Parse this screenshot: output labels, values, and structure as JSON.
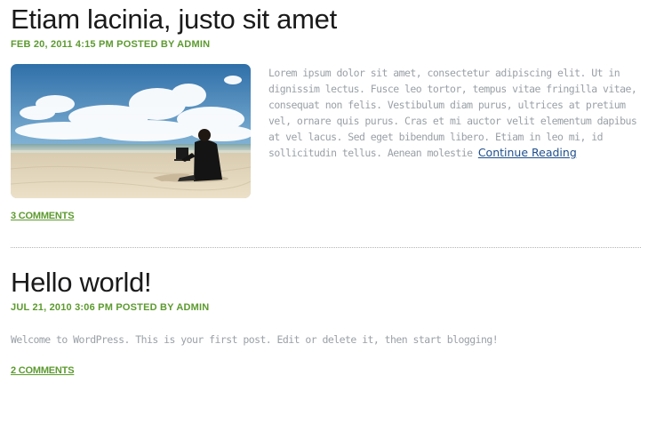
{
  "posts": [
    {
      "title": "Etiam lacinia, justo sit amet",
      "meta": "FEB 20, 2011 4:15 PM POSTED BY ADMIN",
      "excerpt": "Lorem ipsum dolor sit amet, consectetur adipiscing elit. Ut in dignissim lectus. Fusce leo tortor, tempus vitae fringilla vitae, consequat non felis. Vestibulum diam purus, ultrices at pretium vel, ornare quis purus. Cras et mi auctor velit elementum dapibus at vel lacus. Sed eget bibendum libero. Etiam in leo mi, id sollicitudin tellus. Aenean molestie",
      "read_more": "Continue Reading",
      "comments": "3 COMMENTS"
    },
    {
      "title": "Hello world!",
      "meta": "JUL 21, 2010 3:06 PM POSTED BY ADMIN",
      "excerpt": "Welcome to WordPress. This is your first post. Edit or delete it, then start blogging!",
      "comments": "2 COMMENTS"
    }
  ],
  "colors": {
    "meta": "#5c9a2e",
    "body_text": "#9aa0a6",
    "link": "#1e4e8c",
    "title": "#1a1a1a"
  }
}
